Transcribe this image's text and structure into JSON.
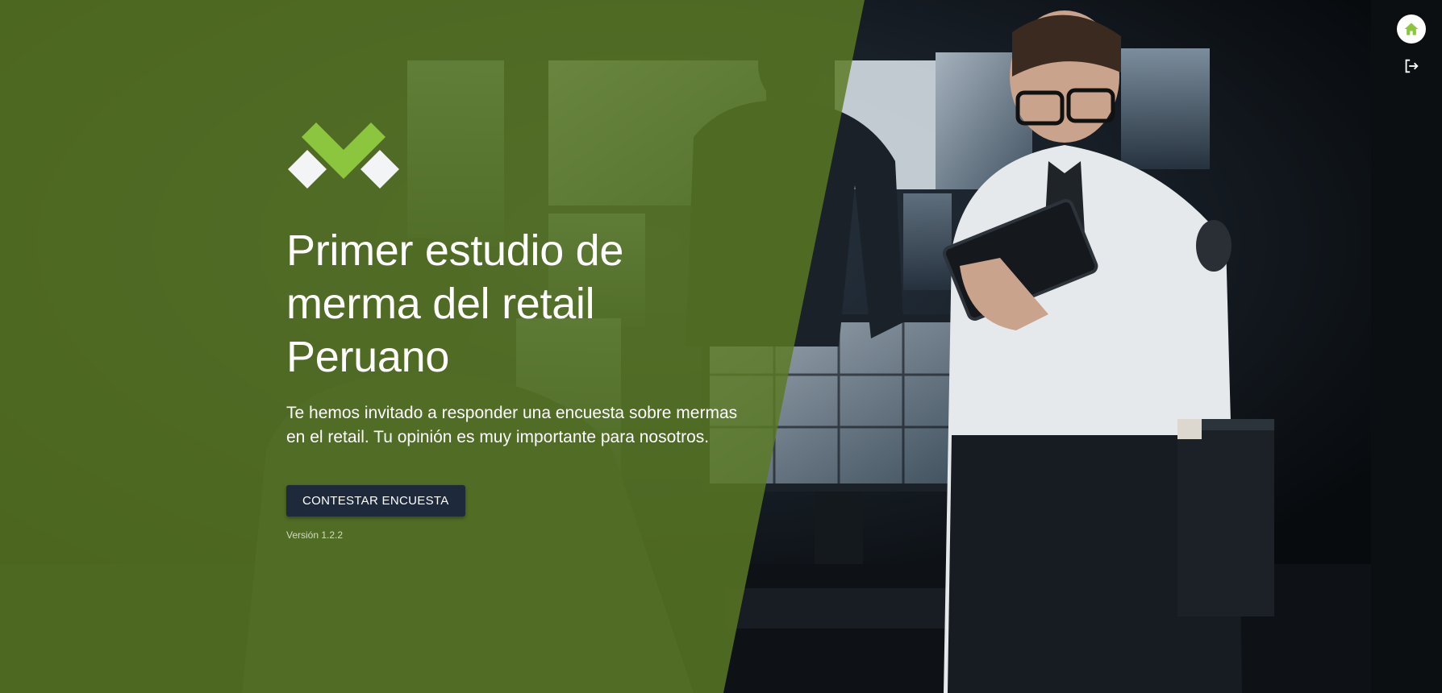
{
  "hero": {
    "title": "Primer estudio de merma del retail Peruano",
    "subtitle": "Te hemos invitado a responder una encuesta sobre mermas en el retail. Tu opinión es muy importante para nosotros.",
    "cta_label": "CONTESTAR ENCUESTA",
    "version": "Versión 1.2.2"
  },
  "top_actions": {
    "home_icon": "home-icon",
    "logout_icon": "logout-icon"
  },
  "colors": {
    "overlay_green": "#5a7a23",
    "logo_green": "#8cc63f",
    "logo_white": "#f2f4f6",
    "button_bg": "#1e2a3c"
  }
}
